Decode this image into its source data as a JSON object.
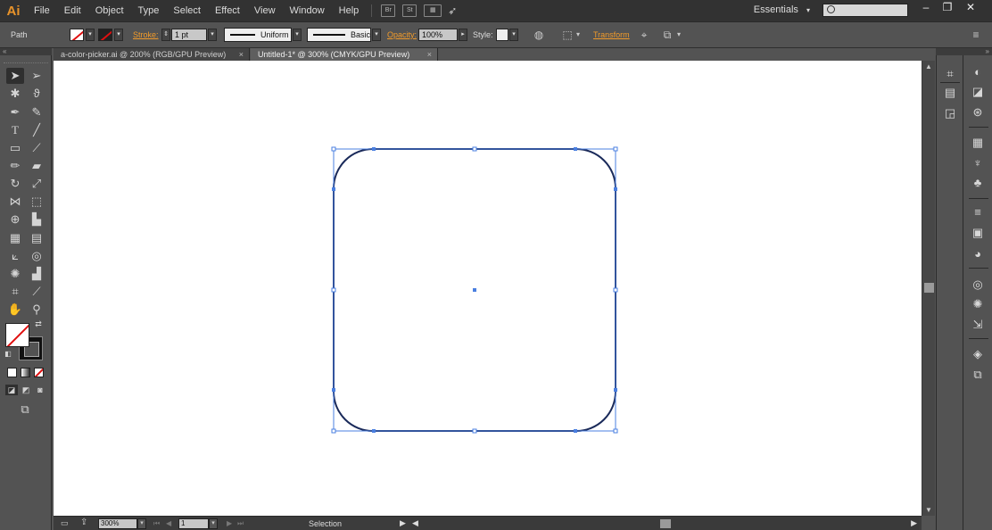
{
  "app": {
    "logo": "Ai",
    "workspace": "Essentials",
    "workspace_caret": "▾"
  },
  "menu": [
    "File",
    "Edit",
    "Object",
    "Type",
    "Select",
    "Effect",
    "View",
    "Window",
    "Help"
  ],
  "menu_buttons": {
    "bridge": "Br",
    "stock": "St"
  },
  "window_controls": {
    "minimize": "–",
    "restore": "❐",
    "close": "✕"
  },
  "control_bar": {
    "selection_type": "Path",
    "stroke_label": "Stroke:",
    "stroke_weight": "1 pt",
    "variable_width": "Uniform",
    "brush": "Basic",
    "opacity_label": "Opacity:",
    "opacity_value": "100%",
    "style_label": "Style:",
    "transform_label": "Transform"
  },
  "tabs": [
    {
      "label": "a-color-picker.ai @ 200% (RGB/GPU Preview)",
      "active": false
    },
    {
      "label": "Untitled-1* @ 300% (CMYK/GPU Preview)",
      "active": true
    }
  ],
  "tab_close": "×",
  "status_bar": {
    "zoom": "300%",
    "artboard": "1",
    "tool_status": "Selection"
  },
  "tools_icons": [
    "selection-tool-icon",
    "direct-selection-tool-icon",
    "magic-wand-tool-icon",
    "lasso-tool-icon",
    "pen-tool-icon",
    "curvature-tool-icon",
    "type-tool-icon",
    "line-segment-tool-icon",
    "rectangle-tool-icon",
    "paintbrush-tool-icon",
    "pencil-tool-icon",
    "eraser-tool-icon",
    "rotate-tool-icon",
    "scale-tool-icon",
    "width-tool-icon",
    "free-transform-tool-icon",
    "shape-builder-tool-icon",
    "perspective-grid-tool-icon",
    "mesh-tool-icon",
    "gradient-tool-icon",
    "eyedropper-tool-icon",
    "blend-tool-icon",
    "symbol-sprayer-tool-icon",
    "column-graph-tool-icon",
    "artboard-tool-icon",
    "slice-tool-icon",
    "hand-tool-icon",
    "zoom-tool-icon"
  ],
  "colors": {
    "accent": "#f29b2a",
    "selection": "#4a7fe0",
    "path_stroke": "#1a2a5a",
    "canvas": "#ffffff",
    "chrome": "#535353"
  }
}
